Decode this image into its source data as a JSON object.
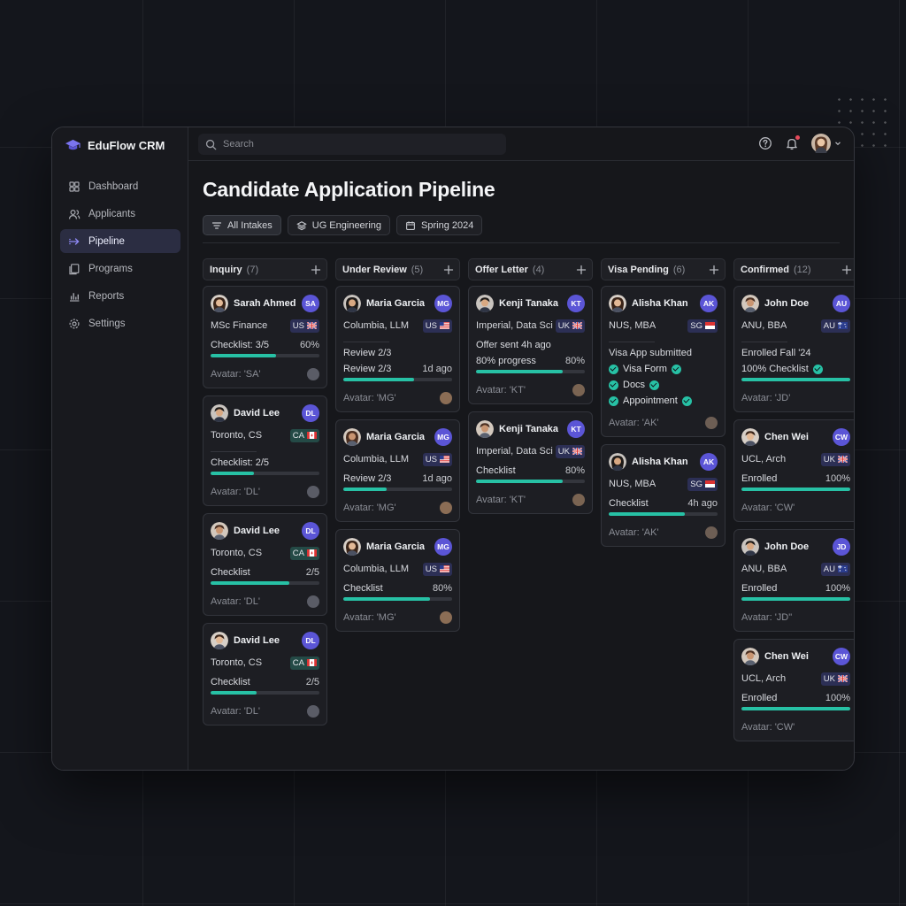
{
  "app": {
    "name": "EduFlow CRM"
  },
  "sidebar": {
    "items": [
      {
        "label": "Dashboard",
        "icon": "dashboard-icon"
      },
      {
        "label": "Applicants",
        "icon": "users-icon"
      },
      {
        "label": "Pipeline",
        "icon": "pipeline-icon",
        "active": true
      },
      {
        "label": "Programs",
        "icon": "programs-icon"
      },
      {
        "label": "Reports",
        "icon": "reports-icon"
      },
      {
        "label": "Settings",
        "icon": "settings-icon"
      }
    ]
  },
  "search": {
    "placeholder": "Search"
  },
  "page": {
    "title": "Candidate Application Pipeline"
  },
  "filters": [
    {
      "label": "All Intakes",
      "icon": "filter-icon"
    },
    {
      "label": "UG Engineering",
      "icon": "layers-icon"
    },
    {
      "label": "Spring 2024",
      "icon": "calendar-icon"
    }
  ],
  "colors": {
    "accent": "#5b55d6",
    "progress": "#27c1a5",
    "checkmark": "#27c1a5"
  },
  "columns": [
    {
      "name": "Inquiry",
      "count": "(7)",
      "cards": [
        {
          "name": "Sarah Ahmed",
          "initials": "SA",
          "program": "MSc Finance",
          "country": "US",
          "flag": "uk",
          "rows": [
            {
              "l": "Checklist: 3/5",
              "r": "60%",
              "p": 0.6
            }
          ],
          "avatar": "Avatar: 'SA'"
        },
        {
          "name": "David Lee",
          "initials": "DL",
          "program": "Toronto, CS",
          "country": "CA",
          "flag": "ca",
          "sep": true,
          "rows": [
            {
              "l": "Checklist: 2/5",
              "r": "",
              "p": 0.4
            }
          ],
          "avatar": "Avatar: 'DL'"
        },
        {
          "name": "David Lee",
          "initials": "DL",
          "program": "Toronto, CS",
          "country": "CA",
          "flag": "ca",
          "rows": [
            {
              "l": "Checklist",
              "r": "2/5",
              "p": 0.72
            }
          ],
          "avatar": "Avatar: 'DL'"
        },
        {
          "name": "David Lee",
          "initials": "DL",
          "program": "Toronto, CS",
          "country": "CA",
          "flag": "ca",
          "rows": [
            {
              "l": "Checklist",
              "r": "2/5",
              "p": 0.42
            }
          ],
          "avatar": "Avatar: 'DL'"
        }
      ]
    },
    {
      "name": "Under Review",
      "count": "(5)",
      "cards": [
        {
          "name": "Maria Garcia",
          "initials": "MG",
          "program": "Columbia, LLM",
          "country": "US",
          "flag": "us",
          "sep": true,
          "plain": [
            "Review 2/3"
          ],
          "rows": [
            {
              "l": "Review 2/3",
              "r": "1d ago",
              "p": 0.65
            }
          ],
          "avatar": "Avatar: 'MG'"
        },
        {
          "name": "Maria Garcia",
          "initials": "MG",
          "program": "Columbia, LLM",
          "country": "US",
          "flag": "us",
          "rows": [
            {
              "l": "Review 2/3",
              "r": "1d ago",
              "p": 0.4
            }
          ],
          "avatar": "Avatar: 'MG'"
        },
        {
          "name": "Maria Garcia",
          "initials": "MG",
          "program": "Columbia, LLM",
          "country": "US",
          "flag": "us",
          "rows": [
            {
              "l": "Checklist",
              "r": "80%",
              "p": 0.8
            }
          ],
          "avatar": "Avatar: 'MG'"
        }
      ]
    },
    {
      "name": "Offer Letter",
      "count": "(4)",
      "cards": [
        {
          "name": "Kenji Tanaka",
          "initials": "KT",
          "program": "Imperial, Data Sci",
          "country": "UK",
          "flag": "uk",
          "plain": [
            "Offer sent 4h ago"
          ],
          "rows": [
            {
              "l": "80% progress",
              "r": "80%",
              "p": 0.8
            }
          ],
          "avatar": "Avatar: 'KT'"
        },
        {
          "name": "Kenji Tanaka",
          "initials": "KT",
          "program": "Imperial, Data Sci",
          "country": "UK",
          "flag": "uk",
          "rows": [
            {
              "l": "Checklist",
              "r": "80%",
              "p": 0.8
            }
          ],
          "avatar": "Avatar: 'KT'"
        }
      ]
    },
    {
      "name": "Visa Pending",
      "count": "(6)",
      "cards": [
        {
          "name": "Alisha Khan",
          "initials": "AK",
          "program": "NUS, MBA",
          "country": "SG",
          "flag": "sg",
          "sep": true,
          "plain": [
            "Visa App submitted"
          ],
          "checks": [
            "Visa Form",
            "Docs",
            "Appointment"
          ],
          "rows": [],
          "avatar": "Avatar: 'AK'"
        },
        {
          "name": "Alisha Khan",
          "initials": "AK",
          "program": "NUS, MBA",
          "country": "SG",
          "flag": "sg",
          "rows": [
            {
              "l": "Checklist",
              "r": "4h ago",
              "p": 0.7
            }
          ],
          "avatar": "Avatar: 'AK'"
        }
      ]
    },
    {
      "name": "Confirmed",
      "count": "(12)",
      "cards": [
        {
          "name": "John Doe",
          "initials": "AU",
          "program": "ANU, BBA",
          "country": "AU",
          "flag": "au",
          "sep": true,
          "plain": [
            "Enrolled Fall '24"
          ],
          "rows": [
            {
              "l": "100% Checklist",
              "r": "",
              "p": 1.0,
              "tick": true
            }
          ],
          "avatar": "Avatar: 'JD'"
        },
        {
          "name": "Chen Wei",
          "initials": "CW",
          "program": "UCL, Arch",
          "country": "UK",
          "flag": "uk",
          "rows": [
            {
              "l": "Enrolled",
              "r": "100%",
              "p": 1.0
            }
          ],
          "avatar": "Avatar: 'CW'"
        },
        {
          "name": "John Doe",
          "initials": "JD",
          "program": "ANU, BBA",
          "country": "AU",
          "flag": "au",
          "rows": [
            {
              "l": "Enrolled",
              "r": "100%",
              "p": 1.0
            }
          ],
          "avatar": "Avatar: 'JD\""
        },
        {
          "name": "Chen Wei",
          "initials": "CW",
          "program": "UCL, Arch",
          "country": "UK",
          "flag": "uk",
          "rows": [
            {
              "l": "Enrolled",
              "r": "100%",
              "p": 1.0
            }
          ],
          "avatar": "Avatar: 'CW'"
        }
      ]
    }
  ]
}
